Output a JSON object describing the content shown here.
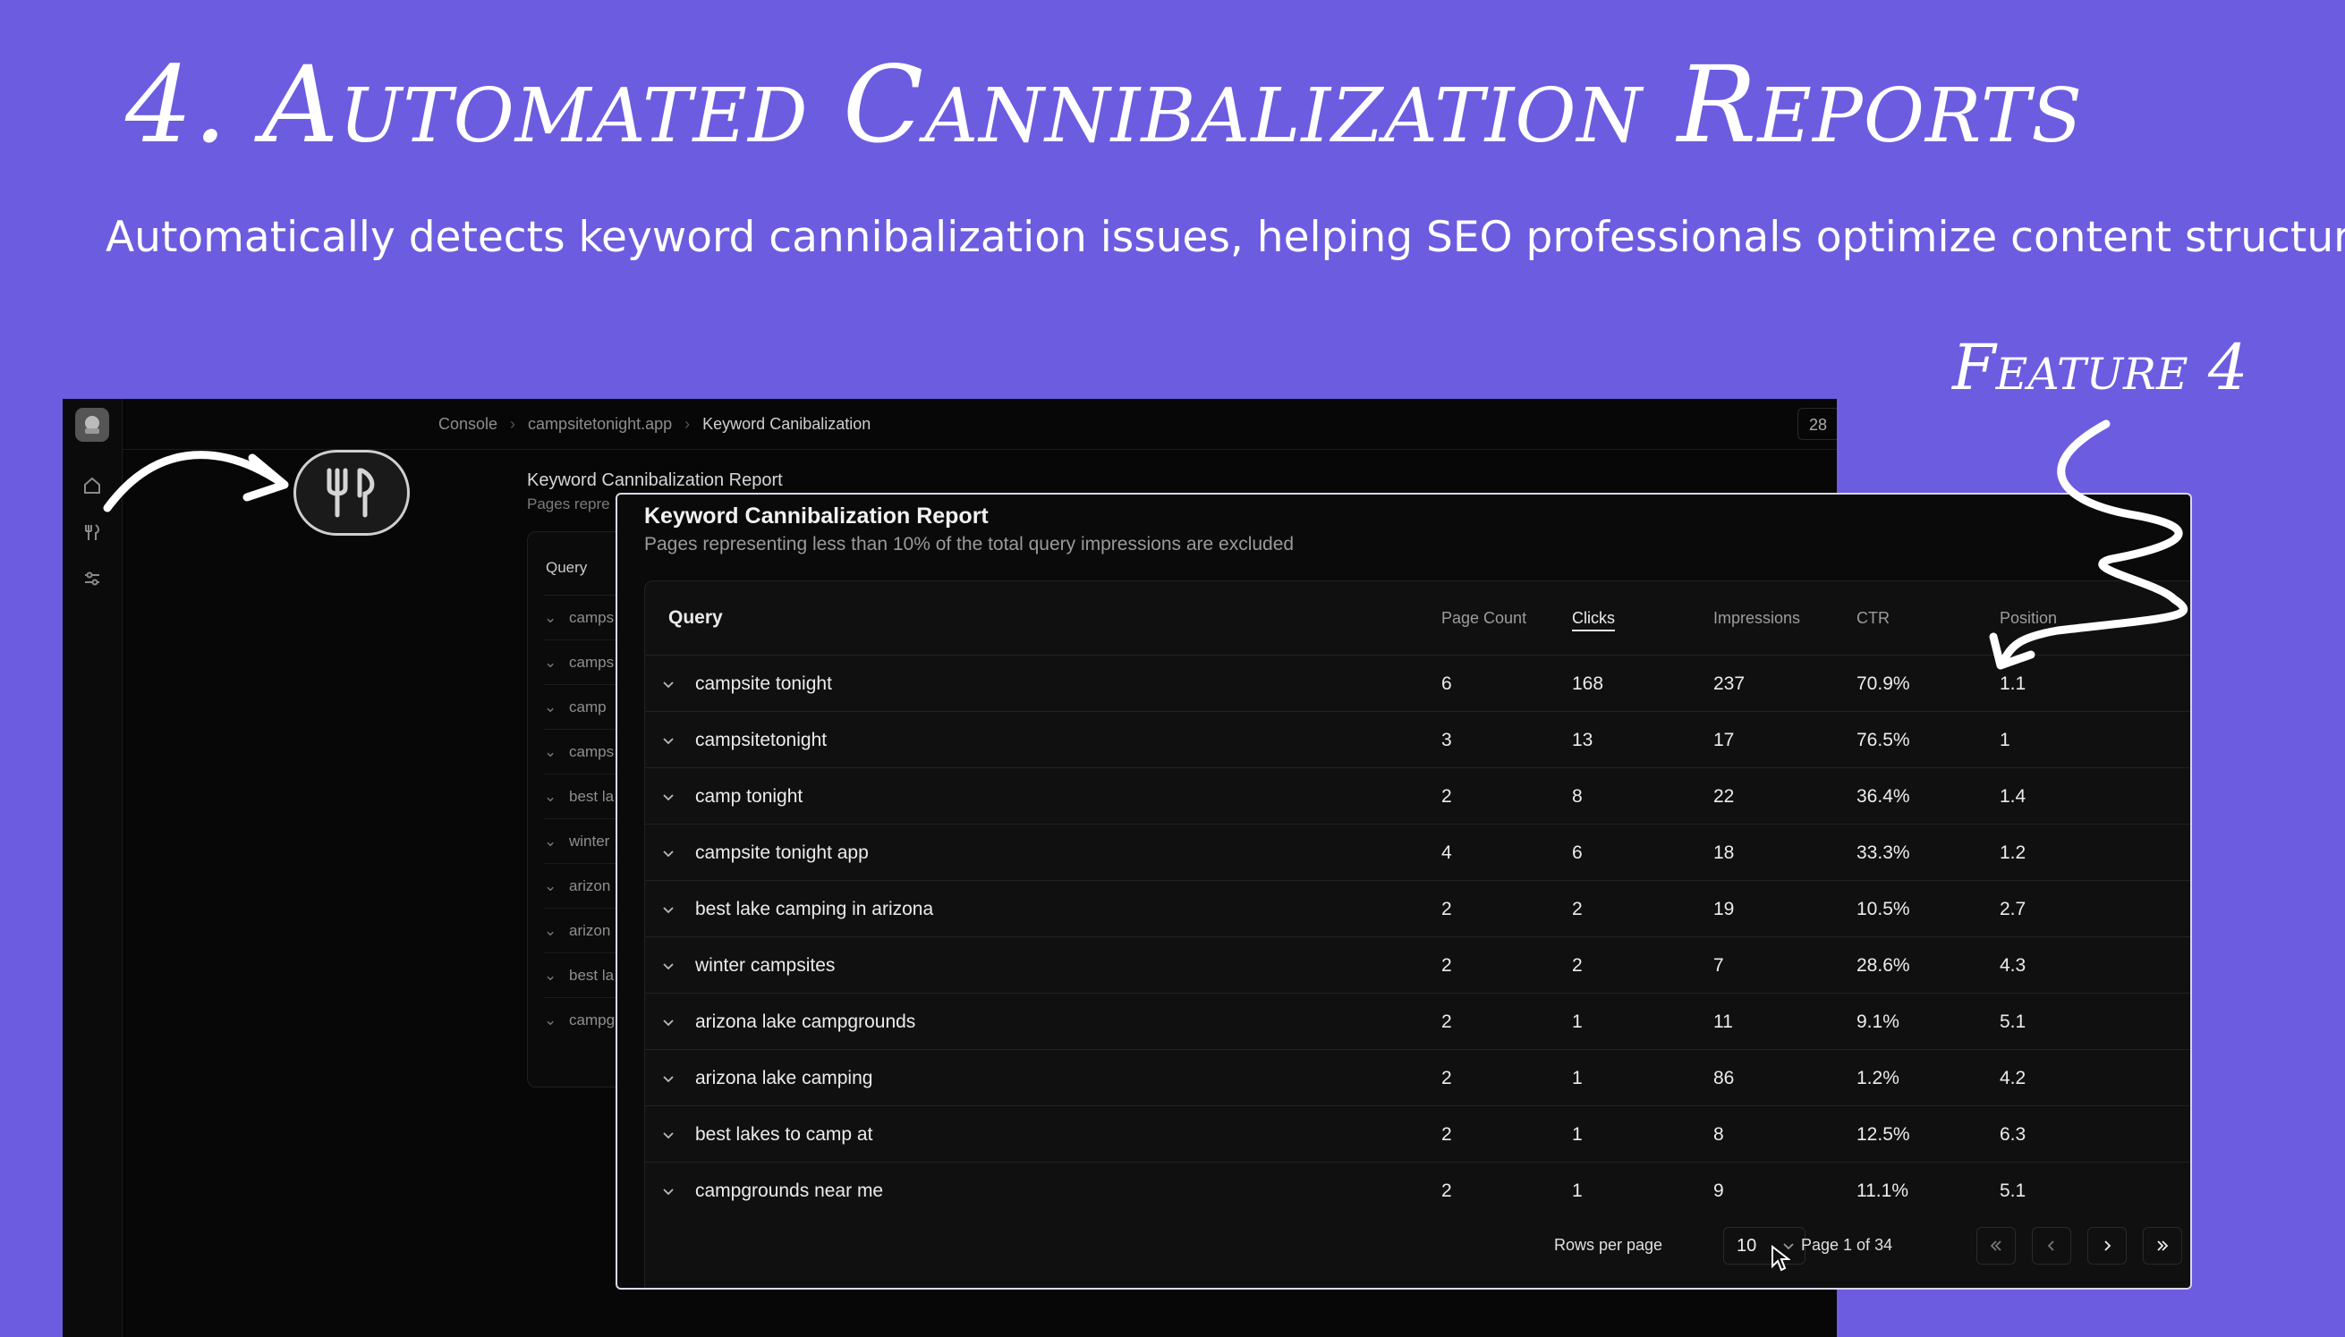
{
  "headline": "4. Automated Cannibalization Reports",
  "subheadline": "Automatically detects keyword cannibalization issues, helping SEO professionals optimize content structure.",
  "feature_tag": "Feature 4",
  "background_app": {
    "breadcrumbs": [
      "Console",
      "campsitetonight.app",
      "Keyword Canibalization"
    ],
    "top_badge": "28",
    "report_title": "Keyword Cannibalization Report",
    "report_sub": "Pages repre",
    "query_header": "Query",
    "rows": [
      "camps",
      "camps",
      "camp",
      "camps",
      "best la",
      "winter",
      "arizon",
      "arizon",
      "best la",
      "campg"
    ],
    "sidebar_icons": [
      "home-icon",
      "fork-knife-icon",
      "sliders-icon"
    ]
  },
  "report": {
    "title": "Keyword Cannibalization Report",
    "subtitle": "Pages representing less than 10% of the total query impressions are excluded",
    "columns": {
      "query": "Query",
      "page_count": "Page Count",
      "clicks": "Clicks",
      "impressions": "Impressions",
      "ctr": "CTR",
      "position": "Position"
    },
    "rows": [
      {
        "query": "campsite tonight",
        "page_count": "6",
        "clicks": "168",
        "impressions": "237",
        "ctr": "70.9%",
        "position": "1.1"
      },
      {
        "query": "campsitetonight",
        "page_count": "3",
        "clicks": "13",
        "impressions": "17",
        "ctr": "76.5%",
        "position": "1"
      },
      {
        "query": "camp tonight",
        "page_count": "2",
        "clicks": "8",
        "impressions": "22",
        "ctr": "36.4%",
        "position": "1.4"
      },
      {
        "query": "campsite tonight app",
        "page_count": "4",
        "clicks": "6",
        "impressions": "18",
        "ctr": "33.3%",
        "position": "1.2"
      },
      {
        "query": "best lake camping in arizona",
        "page_count": "2",
        "clicks": "2",
        "impressions": "19",
        "ctr": "10.5%",
        "position": "2.7"
      },
      {
        "query": "winter campsites",
        "page_count": "2",
        "clicks": "2",
        "impressions": "7",
        "ctr": "28.6%",
        "position": "4.3"
      },
      {
        "query": "arizona lake campgrounds",
        "page_count": "2",
        "clicks": "1",
        "impressions": "11",
        "ctr": "9.1%",
        "position": "5.1"
      },
      {
        "query": "arizona lake camping",
        "page_count": "2",
        "clicks": "1",
        "impressions": "86",
        "ctr": "1.2%",
        "position": "4.2"
      },
      {
        "query": "best lakes to camp at",
        "page_count": "2",
        "clicks": "1",
        "impressions": "8",
        "ctr": "12.5%",
        "position": "6.3"
      },
      {
        "query": "campgrounds near me",
        "page_count": "2",
        "clicks": "1",
        "impressions": "9",
        "ctr": "11.1%",
        "position": "5.1"
      }
    ],
    "footer": {
      "rows_per_page_label": "Rows per page",
      "rows_per_page_value": "10",
      "page_info": "Page 1 of 34"
    },
    "icons": {
      "row_toggle": "chevron-down-icon",
      "first": "chevrons-left-icon",
      "prev": "chevron-left-icon",
      "next": "chevron-right-icon",
      "last": "chevrons-right-icon"
    }
  }
}
